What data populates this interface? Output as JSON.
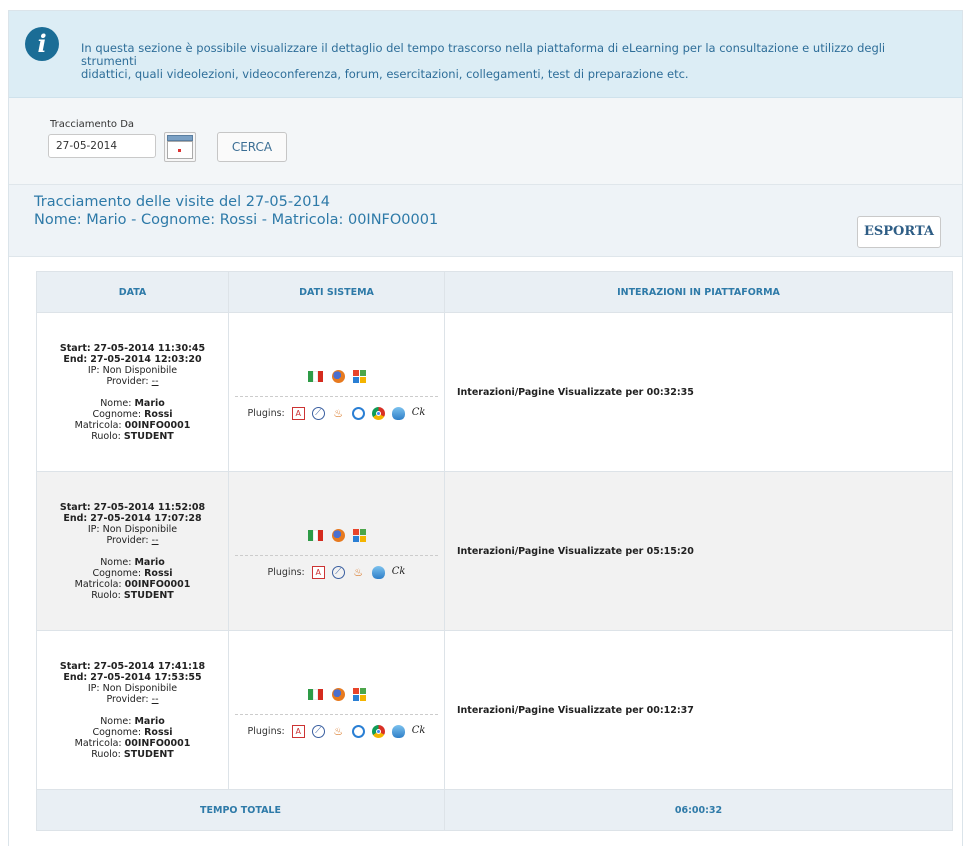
{
  "info": {
    "line1": "In questa sezione è possibile visualizzare il dettaglio del tempo trascorso nella piattaforma di eLearning per la consultazione e utilizzo degli strumenti",
    "line2": "didattici, quali videolezioni, videoconferenza, forum, esercitazioni, collegamenti, test di preparazione etc."
  },
  "search": {
    "label": "Tracciamento Da",
    "date_value": "27-05-2014",
    "search_button": "CERCA"
  },
  "title": {
    "line1": "Tracciamento delle visite del 27-05-2014",
    "line2": "Nome: Mario - Cognome: Rossi - Matricola: 00INFO0001",
    "export_button": "ESPORTA"
  },
  "table": {
    "headers": [
      "DATA",
      "DATI SISTEMA",
      "INTERAZIONI IN PIATTAFORMA"
    ],
    "plugins_label": "Plugins:",
    "rows": [
      {
        "start_label": "Start:",
        "start": "27-05-2014 11:30:45",
        "end_label": "End:",
        "end": "27-05-2014 12:03:20",
        "ip": "IP: Non Disponibile",
        "provider_label": "Provider:",
        "provider": "--",
        "nome_label": "Nome:",
        "nome": "Mario",
        "cognome_label": "Cognome:",
        "cognome": "Rossi",
        "matricola_label": "Matricola:",
        "matricola": "00INFO0001",
        "ruolo_label": "Ruolo:",
        "ruolo": "STUDENT",
        "interactions": "Interazioni/Pagine Visualizzate per 00:32:35",
        "plugins": [
          "pdf-icon",
          "safari-icon",
          "java-icon",
          "quicktime-icon",
          "chrome-icon",
          "wmp-icon",
          "ck-icon"
        ]
      },
      {
        "start_label": "Start:",
        "start": "27-05-2014 11:52:08",
        "end_label": "End:",
        "end": "27-05-2014 17:07:28",
        "ip": "IP: Non Disponibile",
        "provider_label": "Provider:",
        "provider": "--",
        "nome_label": "Nome:",
        "nome": "Mario",
        "cognome_label": "Cognome:",
        "cognome": "Rossi",
        "matricola_label": "Matricola:",
        "matricola": "00INFO0001",
        "ruolo_label": "Ruolo:",
        "ruolo": "STUDENT",
        "interactions": "Interazioni/Pagine Visualizzate per 05:15:20",
        "plugins": [
          "pdf-icon",
          "safari-icon",
          "java-icon",
          "wmp-icon",
          "ck-icon"
        ]
      },
      {
        "start_label": "Start:",
        "start": "27-05-2014 17:41:18",
        "end_label": "End:",
        "end": "27-05-2014 17:53:55",
        "ip": "IP: Non Disponibile",
        "provider_label": "Provider:",
        "provider": "--",
        "nome_label": "Nome:",
        "nome": "Mario",
        "cognome_label": "Cognome:",
        "cognome": "Rossi",
        "matricola_label": "Matricola:",
        "matricola": "00INFO0001",
        "ruolo_label": "Ruolo:",
        "ruolo": "STUDENT",
        "interactions": "Interazioni/Pagine Visualizzate per 00:12:37",
        "plugins": [
          "pdf-icon",
          "safari-icon",
          "java-icon",
          "quicktime-icon",
          "chrome-icon",
          "wmp-icon",
          "ck-icon"
        ]
      }
    ],
    "total_label": "TEMPO TOTALE",
    "total_value": "06:00:32"
  },
  "colors": {
    "accent": "#2e7aa8",
    "info_bg": "#dcedf5",
    "info_icon": "#1b6d96",
    "header_bg": "#e9eff4"
  }
}
